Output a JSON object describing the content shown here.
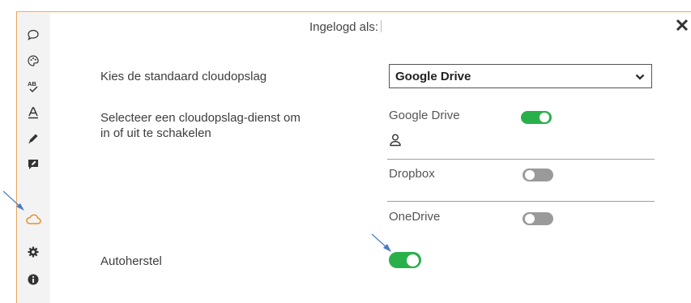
{
  "header": {
    "logged_in_label": "Ingelogd als:"
  },
  "sidebar": {
    "items": [
      {
        "icon": "speech-bubble-icon"
      },
      {
        "icon": "palette-icon"
      },
      {
        "icon": "spellcheck-icon"
      },
      {
        "icon": "text-style-icon"
      },
      {
        "icon": "pencil-icon"
      },
      {
        "icon": "comment-edit-icon"
      },
      {
        "icon": "cloud-icon",
        "active": true
      },
      {
        "icon": "gear-icon"
      },
      {
        "icon": "info-icon"
      }
    ]
  },
  "settings": {
    "default_storage_label": "Kies de standaard cloudopslag",
    "default_storage_value": "Google Drive",
    "toggle_services_label_line1": "Selecteer een cloudopslag-dienst om",
    "toggle_services_label_line2": "in of uit te schakelen",
    "services": [
      {
        "name": "Google Drive",
        "enabled": true
      },
      {
        "name": "Dropbox",
        "enabled": false
      },
      {
        "name": "OneDrive",
        "enabled": false
      }
    ],
    "autorecover_label": "Autoherstel",
    "autorecover_enabled": true
  },
  "colors": {
    "accent_orange": "#f08a24",
    "toggle_on": "#2ab04a",
    "toggle_off": "#9a9a9a",
    "annotation_arrow": "#4a7cc4"
  }
}
